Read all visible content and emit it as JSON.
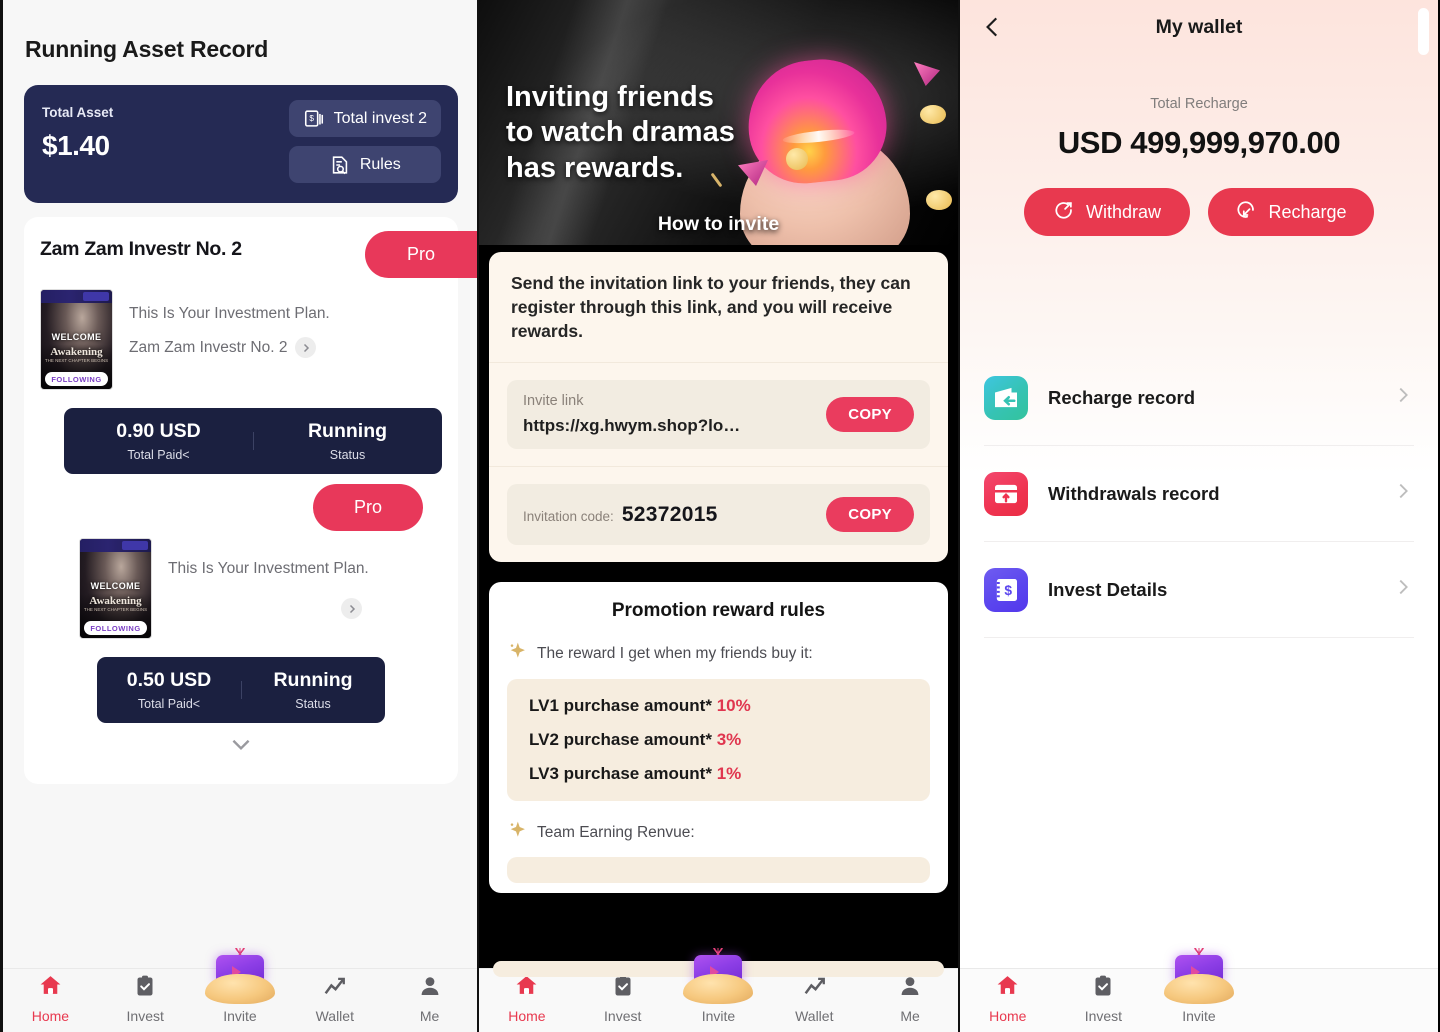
{
  "panel1": {
    "title": "Running Asset Record",
    "asset": {
      "label": "Total Asset",
      "value": "$1.40",
      "total_invest_label": "Total invest 2",
      "rules_label": "Rules"
    },
    "plans": [
      {
        "title": "Zam Zam Investr No. 2",
        "badge": "Pro",
        "desc": "This Is Your Investment Plan.",
        "name": "Zam Zam Investr No. 2",
        "poster": {
          "welcome": "WELCOME",
          "movie": "Awakening",
          "sub": "THE NEXT CHAPTER BEGINS",
          "following": "FOLLOWING"
        },
        "paid_value": "0.90 USD",
        "paid_label": "Total Paid<",
        "status_value": "Running",
        "status_label": "Status"
      },
      {
        "title": "",
        "badge": "Pro",
        "desc": "This Is Your Investment Plan.",
        "name": "",
        "poster": {
          "welcome": "WELCOME",
          "movie": "Awakening",
          "sub": "THE NEXT CHAPTER BEGINS",
          "following": "FOLLOWING"
        },
        "paid_value": "0.50 USD",
        "paid_label": "Total Paid<",
        "status_value": "Running",
        "status_label": "Status"
      }
    ],
    "nav": [
      {
        "label": "Home",
        "icon": "home-icon",
        "active": true
      },
      {
        "label": "Invest",
        "icon": "clipboard-check-icon",
        "active": false
      },
      {
        "label": "Invite",
        "icon": "cake-icon",
        "active": false
      },
      {
        "label": "Wallet",
        "icon": "chart-line-icon",
        "active": false
      },
      {
        "label": "Me",
        "icon": "user-icon",
        "active": false
      }
    ]
  },
  "panel2": {
    "hero": {
      "headline": "Inviting friends\nto watch dramas\nhas rewards.",
      "how_to_invite": "How to invite"
    },
    "invite": {
      "description": "Send the invitation link to your friends, they can register through this link, and you will receive rewards.",
      "link_label": "Invite link",
      "link_value": "https://xg.hwym.shop?lo…",
      "link_copy": "COPY",
      "code_label": "Invitation code:",
      "code_value": "52372015",
      "code_copy": "COPY"
    },
    "rules": {
      "title": "Promotion reward rules",
      "bullet1": "The reward I get when my friends buy it:",
      "levels": [
        {
          "text": "LV1 purchase amount* ",
          "pct": "10%"
        },
        {
          "text": "LV2 purchase amount* ",
          "pct": "3%"
        },
        {
          "text": "LV3 purchase amount* ",
          "pct": "1%"
        }
      ],
      "bullet2": "Team Earning Renvue:"
    },
    "nav": [
      {
        "label": "Home",
        "icon": "home-icon",
        "active": true
      },
      {
        "label": "Invest",
        "icon": "clipboard-check-icon",
        "active": false
      },
      {
        "label": "Invite",
        "icon": "cake-icon",
        "active": false
      },
      {
        "label": "Wallet",
        "icon": "chart-line-icon",
        "active": false
      },
      {
        "label": "Me",
        "icon": "user-icon",
        "active": false
      }
    ]
  },
  "panel3": {
    "title": "My wallet",
    "back_icon": "chevron-left-icon",
    "total_recharge_label": "Total Recharge",
    "total_recharge_value": "USD 499,999,970.00",
    "withdraw_label": "Withdraw",
    "recharge_label": "Recharge",
    "items": [
      {
        "label": "Recharge record",
        "icon": "wallet-in-icon"
      },
      {
        "label": "Withdrawals record",
        "icon": "card-out-icon"
      },
      {
        "label": "Invest Details",
        "icon": "dollar-book-icon"
      }
    ],
    "nav": [
      {
        "label": "Home",
        "icon": "home-icon",
        "active": true
      },
      {
        "label": "Invest",
        "icon": "clipboard-check-icon",
        "active": false
      },
      {
        "label": "Invite",
        "icon": "cake-icon",
        "active": false
      }
    ]
  },
  "colors": {
    "accent_red": "#e8394f",
    "dark_navy": "#252a54",
    "stat_navy": "#1b2040",
    "cream": "#fdf6ed"
  }
}
